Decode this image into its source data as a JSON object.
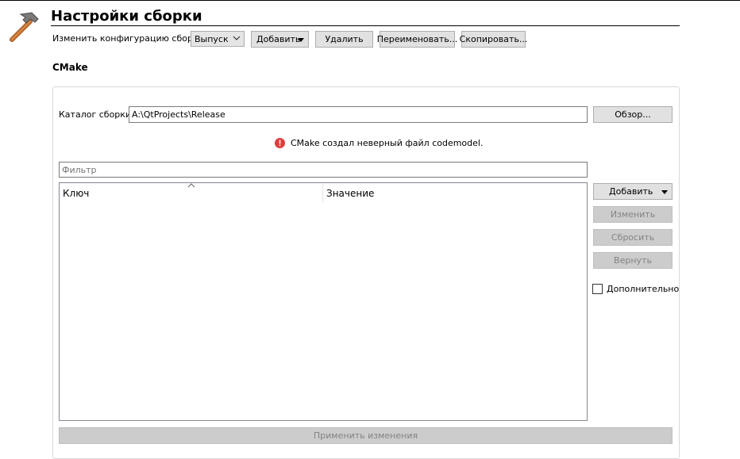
{
  "page_title": "Настройки сборки",
  "config_bar": {
    "label": "Изменить конфигурацию сборки:",
    "selected_config": "Выпуск",
    "add_label": "Добавить",
    "remove_label": "Удалить",
    "rename_label": "Переименовать...",
    "clone_label": "Скопировать..."
  },
  "section_title": "CMake",
  "build_dir": {
    "label": "Каталог сборки:",
    "value": "A:\\QtProjects\\Release",
    "browse_label": "Обзор..."
  },
  "error_message": "CMake создал неверный файл codemodel.",
  "filter": {
    "placeholder": "Фильтр"
  },
  "table": {
    "columns": [
      "Ключ",
      "Значение"
    ],
    "rows": []
  },
  "side_buttons": {
    "add_label": "Добавить",
    "edit_label": "Изменить",
    "reset_label": "Сбросить",
    "revert_label": "Вернуть"
  },
  "advanced_label": "Дополнительно",
  "advanced_checked": false,
  "apply_label": "Применить изменения",
  "colors": {
    "error_icon": "#e03c3c",
    "hammer_handle": "#b5652a",
    "hammer_head": "#7a7a7a"
  },
  "icons": {
    "app_icon": "hammer-icon",
    "error_icon": "error-circle-icon"
  }
}
